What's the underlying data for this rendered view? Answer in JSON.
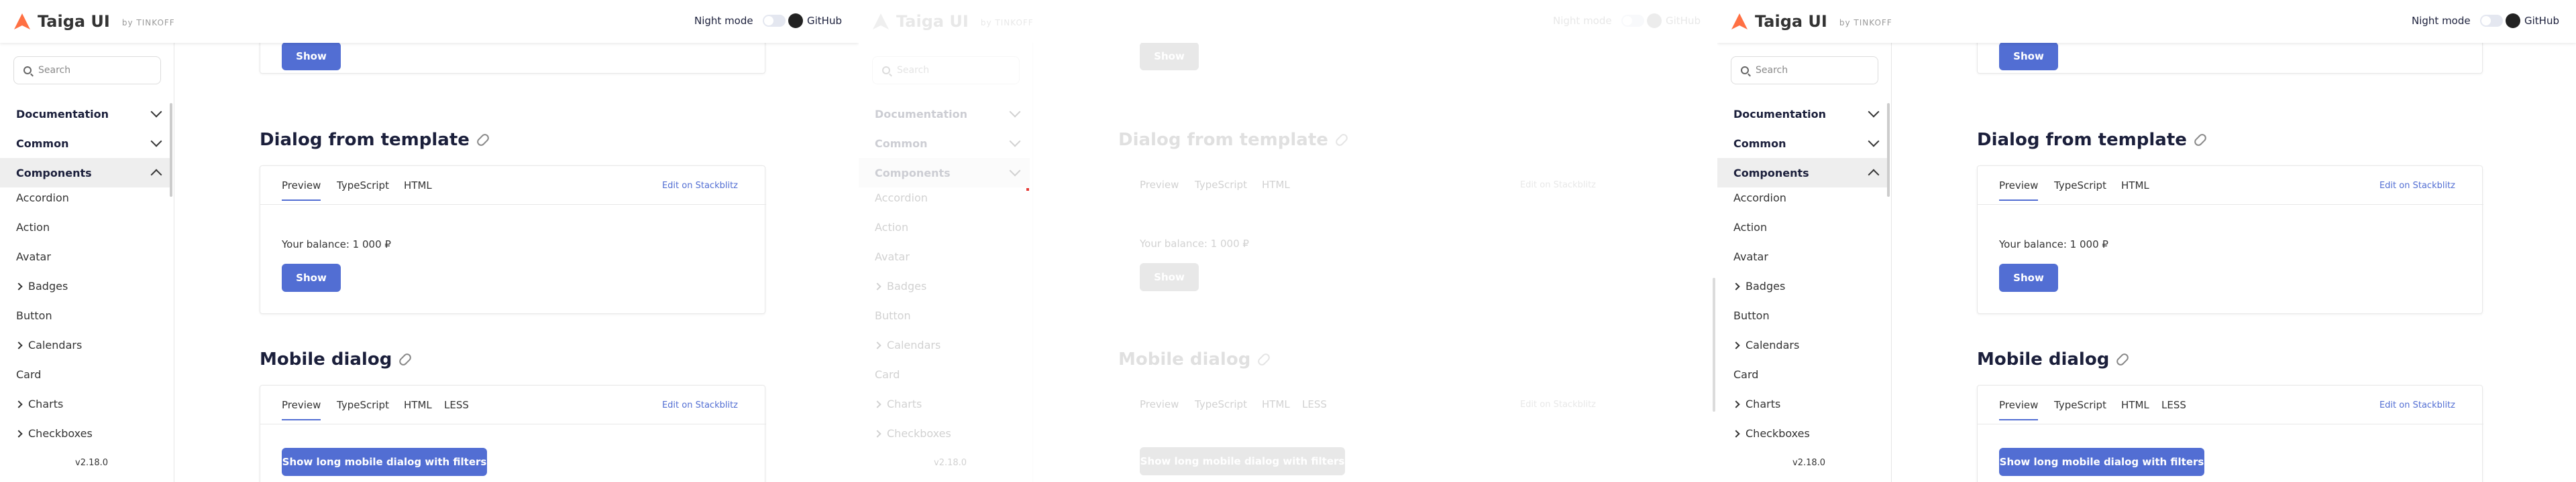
{
  "header": {
    "logo_text": "Taiga UI",
    "logo_by": "by TINKOFF",
    "night_mode": "Night mode",
    "github": "GitHub"
  },
  "sidebar": {
    "search_placeholder": "Search",
    "sections": [
      {
        "label": "Documentation",
        "expanded": false
      },
      {
        "label": "Common",
        "expanded": false
      },
      {
        "label": "Components",
        "expanded": true
      }
    ],
    "items": [
      {
        "label": "Accordion",
        "has_children": false
      },
      {
        "label": "Action",
        "has_children": false
      },
      {
        "label": "Avatar",
        "has_children": false
      },
      {
        "label": "Badges",
        "has_children": true
      },
      {
        "label": "Button",
        "has_children": false
      },
      {
        "label": "Calendars",
        "has_children": true
      },
      {
        "label": "Card",
        "has_children": false
      },
      {
        "label": "Charts",
        "has_children": true
      },
      {
        "label": "Checkboxes",
        "has_children": true
      }
    ],
    "version": "v2.18.0"
  },
  "content": {
    "top_button": "Show",
    "section1": {
      "title": "Dialog from template",
      "tabs": [
        "Preview",
        "TypeScript",
        "HTML"
      ],
      "stackblitz": "Edit on Stackblitz",
      "balance": "Your balance: 1 000 ₽",
      "button": "Show"
    },
    "section2": {
      "title": "Mobile dialog",
      "tabs": [
        "Preview",
        "TypeScript",
        "HTML",
        "LESS"
      ],
      "stackblitz": "Edit on Stackblitz",
      "button": "Show long mobile dialog with filters"
    }
  },
  "colors": {
    "accent": "#526ed3",
    "logo_orange": "#ff7043",
    "active_section_bg": "#eeeeee"
  }
}
